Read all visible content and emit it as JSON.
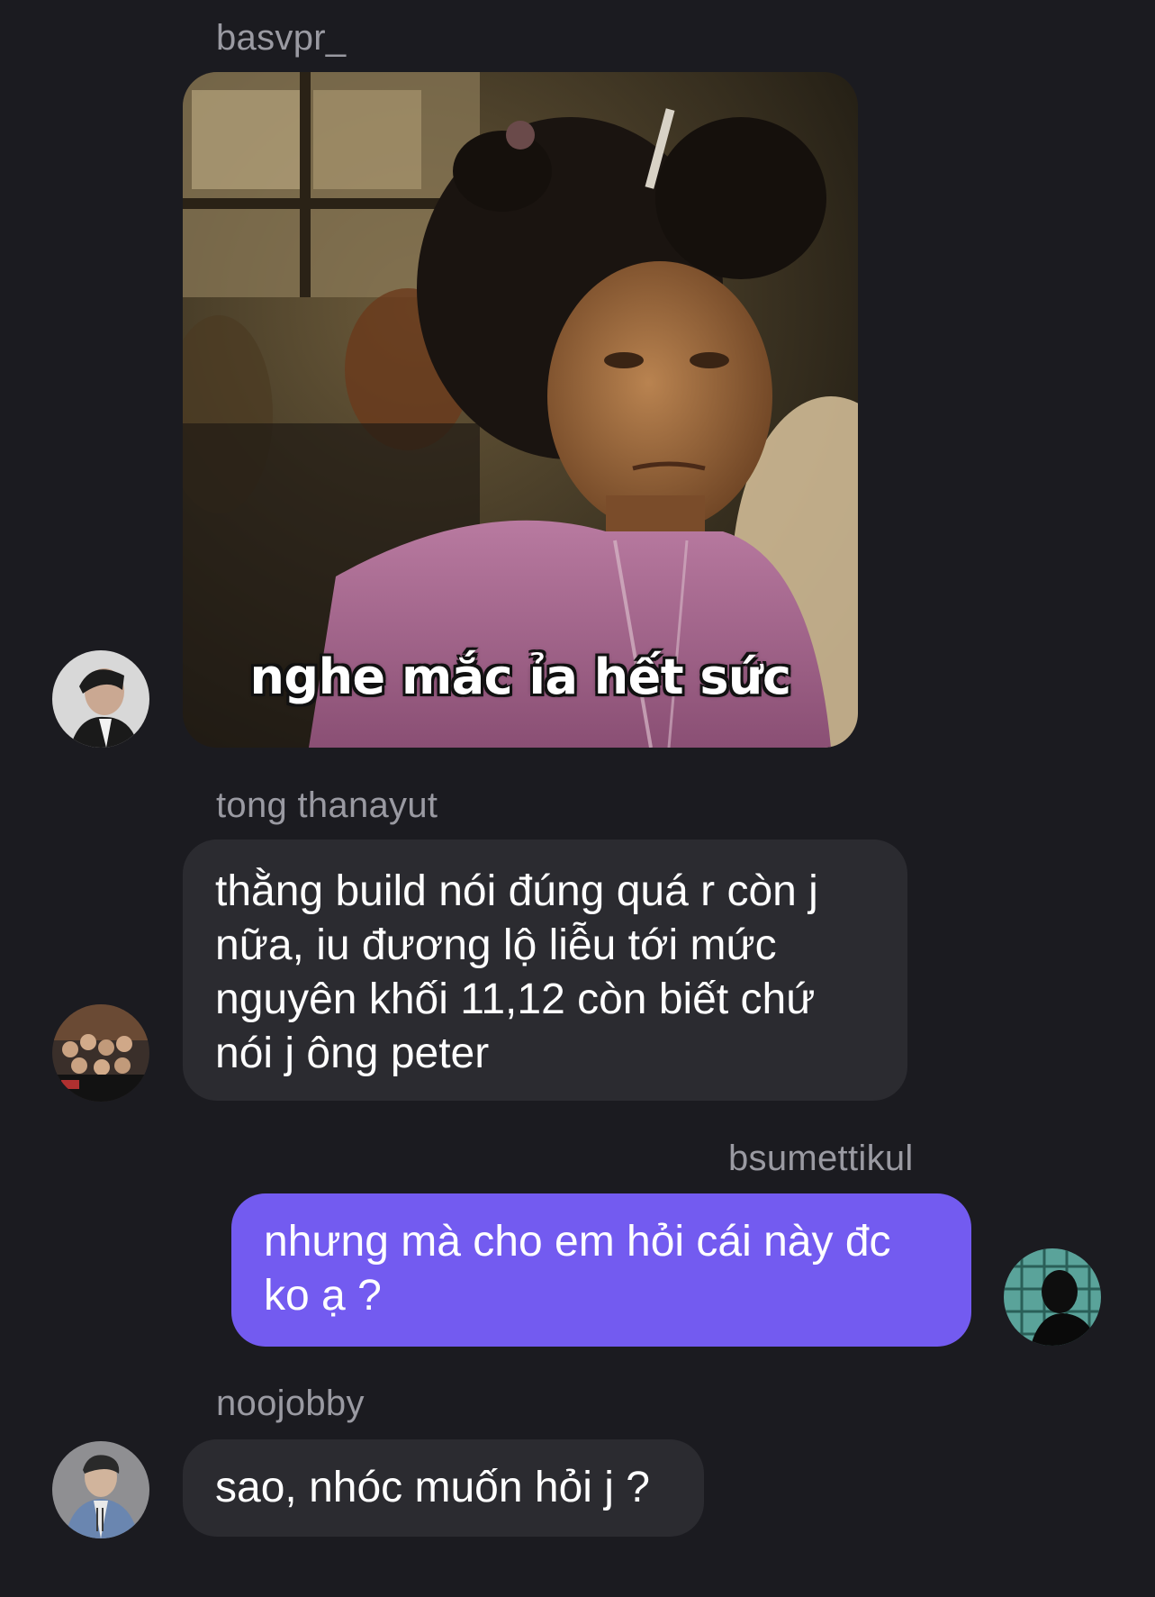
{
  "messages": [
    {
      "sender": "basvpr_",
      "type": "image",
      "image_caption": "nghe mắc ỉa hết sức",
      "direction": "incoming"
    },
    {
      "sender": "tong thanayut",
      "type": "text",
      "lines": [
        "thằng build nói đúng quá r còn j",
        "nữa, iu đương lộ liễu tới mức",
        "nguyên khối 11,12 còn biết chứ",
        "nói j ông peter"
      ],
      "direction": "incoming"
    },
    {
      "sender": "bsumettikul",
      "type": "text",
      "lines": [
        "nhưng mà cho em hỏi cái này đc",
        "ko ạ ?"
      ],
      "direction": "outgoing"
    },
    {
      "sender": "noojobby",
      "type": "text",
      "lines": [
        "sao, nhóc muốn hỏi j ?"
      ],
      "direction": "incoming"
    }
  ],
  "colors": {
    "background": "#1b1b20",
    "incoming_bubble": "#2b2b30",
    "outgoing_bubble": "#735bf0",
    "sender_name": "#9a9aa2"
  }
}
